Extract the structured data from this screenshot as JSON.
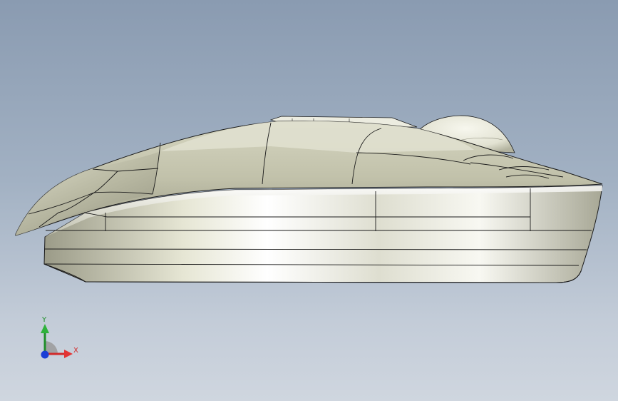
{
  "viewport": {
    "background_top": "#8a9bb1",
    "background_bottom": "#cfd6df"
  },
  "model": {
    "name": "mouse-side-view",
    "body_color": "#d8d8c9",
    "edge_color": "#1a1a1a"
  },
  "triad": {
    "y_label": "Y",
    "x_label": "X",
    "y_color": "#1f8f2a",
    "x_color": "#d12a2a",
    "z_color": "#1c3fd6"
  }
}
